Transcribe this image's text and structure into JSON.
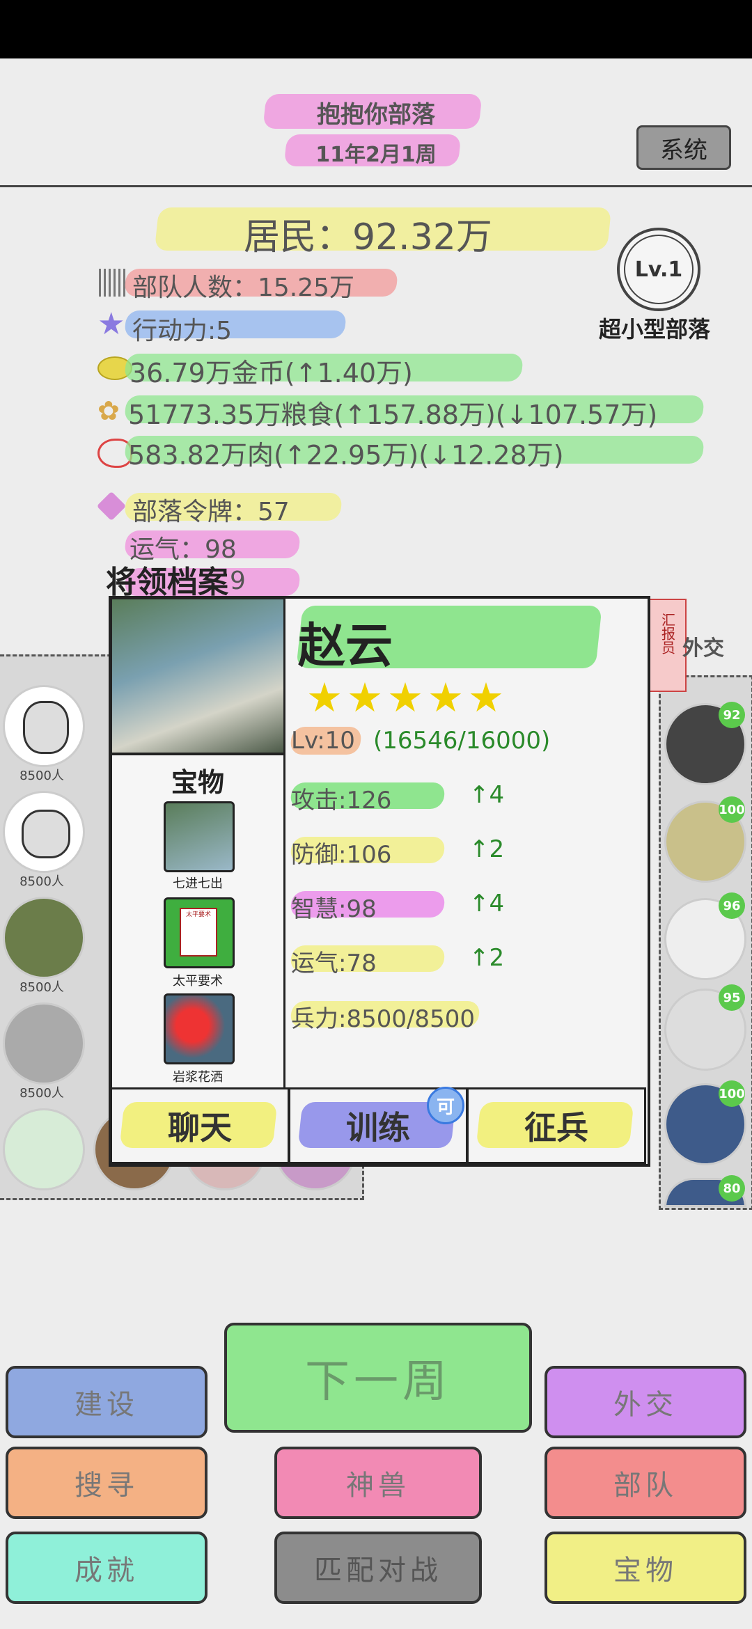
{
  "header": {
    "tribe_name": "抱抱你部落",
    "date": "11年2月1周",
    "system_label": "系统"
  },
  "stats": {
    "residents": "居民：92.32万",
    "troops": "部队人数：15.25万",
    "action": "行动力:5",
    "gold": "36.79万金币(↑1.40万)",
    "grain": "51773.35万粮食(↑157.88万)(↓107.57万)",
    "meat": "583.82万肉(↑22.95万)(↓12.28万)",
    "token": "部落令牌：57",
    "luck": "运气：98",
    "obscured_partial": "9"
  },
  "level": {
    "badge": "Lv.1",
    "title": "超小型部落"
  },
  "left_panel": {
    "section_title": "将领档案",
    "troop_labels": [
      "8500人",
      "8500人",
      "8500人",
      "8500人"
    ]
  },
  "right_panel": {
    "report_tag": "汇报员",
    "diplomacy_label": "外交",
    "badges": [
      "92",
      "100",
      "96",
      "95",
      "100",
      "80"
    ]
  },
  "general": {
    "name": "赵云",
    "stars": 5,
    "level": "Lv:10",
    "exp": "(16546/16000)",
    "treasure_title": "宝物",
    "treasures": [
      "七进七出",
      "太平要术",
      "岩浆花洒"
    ],
    "treasure_book_text": "太平要术",
    "attributes": [
      {
        "label": "攻击:126",
        "up": "↑4",
        "color": "#6de06d"
      },
      {
        "label": "防御:106",
        "up": "↑2",
        "color": "#f2ef7a"
      },
      {
        "label": "智慧:98",
        "up": "↑4",
        "color": "#e97fe9"
      },
      {
        "label": "运气:78",
        "up": "↑2",
        "color": "#f2ef7a"
      }
    ],
    "troops": "兵力:8500/8500",
    "buttons": {
      "chat": "聊天",
      "train": "训练",
      "train_badge": "可",
      "recruit": "征兵"
    }
  },
  "bottom": {
    "next_week": "下一周",
    "build": "建设",
    "diplomacy": "外交",
    "search": "搜寻",
    "beast": "神兽",
    "army": "部队",
    "achievement": "成就",
    "match": "匹配对战",
    "treasure": "宝物"
  },
  "colors": {
    "pink": "#ef8fdc",
    "yellow": "#f1ef86",
    "blue": "#8fb4ef",
    "green": "#8fe68f",
    "orange": "#f4b184",
    "red": "#f38d8d",
    "cyan": "#8ff0d9",
    "gray": "#8c8c8c",
    "purple": "#cf8fef"
  }
}
